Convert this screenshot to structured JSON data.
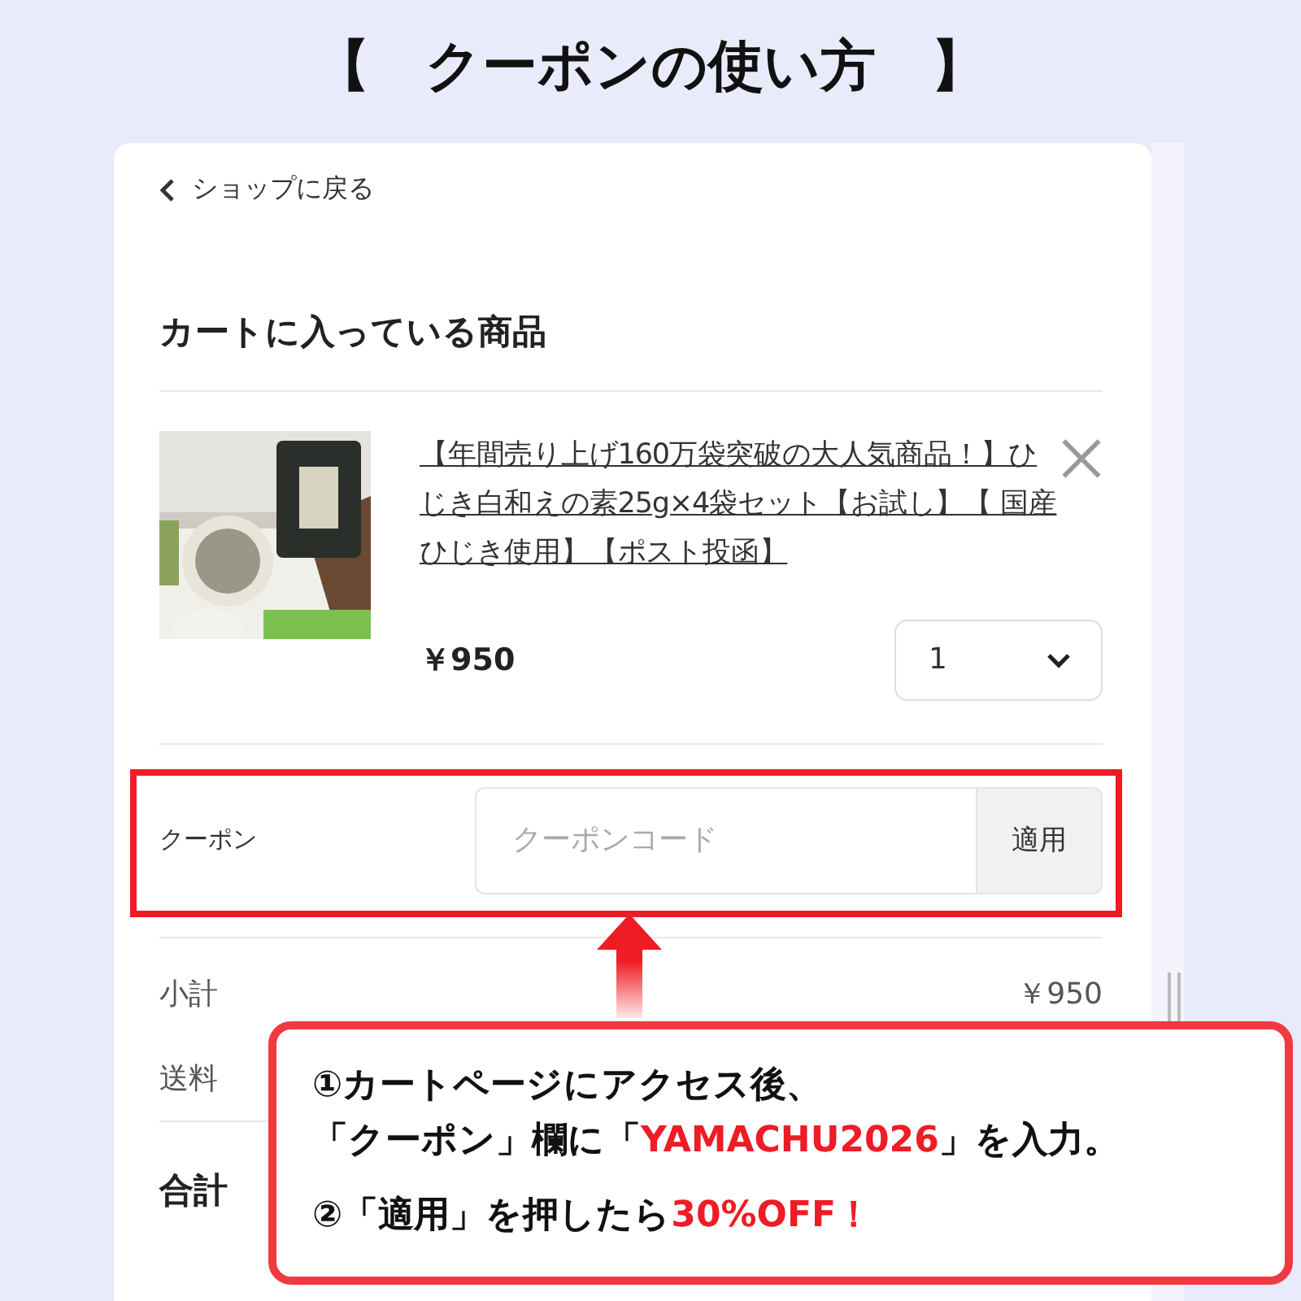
{
  "title": "【　クーポンの使い方　】",
  "cart": {
    "back_link": "ショップに戻る",
    "heading": "カートに入っている商品",
    "items": [
      {
        "kind": "picture",
        "name": "【年間売り上げ160万袋突破の大人気商品！】ひじき白和えの素25g×4袋セット【お試し】【 国産ひじき使用】【ポスト投函】",
        "price": "￥950",
        "quantity": "1"
      }
    ],
    "coupon": {
      "label": "クーポン",
      "placeholder": "クーポンコード",
      "button": "適用"
    },
    "totals": [
      {
        "label": "小計",
        "value": "￥950",
        "bold": false
      },
      {
        "label": "送料",
        "bold": false
      },
      {
        "label": "合計",
        "bold": true
      }
    ]
  },
  "callout": {
    "paragraphs": [
      [
        {
          "text": "①カートページにアクセス後、",
          "emphasis": false
        }
      ],
      [
        {
          "text": "「クーポン」欄に「",
          "emphasis": false
        },
        {
          "text": "YAMACHU2026",
          "emphasis": true
        },
        {
          "text": "」を入力。",
          "emphasis": false
        }
      ],
      [
        {
          "text": "②「適用」を押したら",
          "emphasis": false
        },
        {
          "text": "30%OFF！",
          "emphasis": true
        }
      ]
    ]
  }
}
